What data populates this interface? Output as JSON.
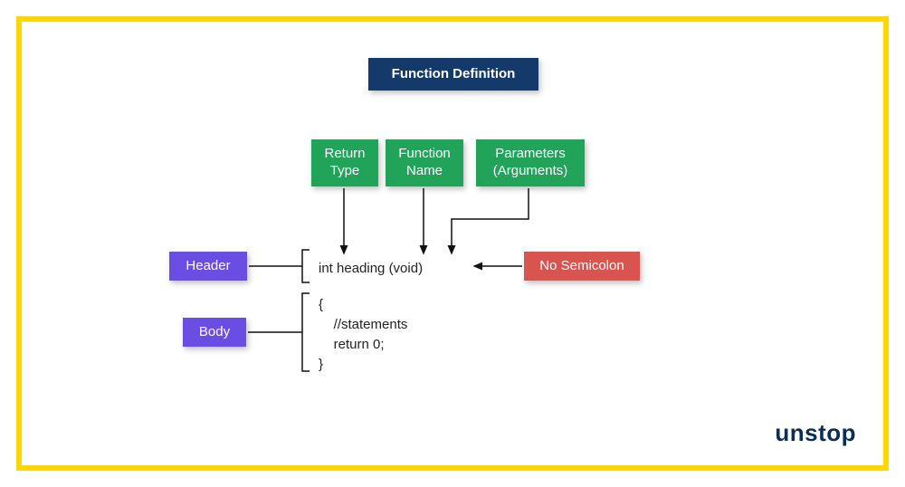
{
  "title": "Function Definition",
  "labels": {
    "return_type": "Return\nType",
    "function_name": "Function\nName",
    "parameters": "Parameters\n(Arguments)",
    "header": "Header",
    "body": "Body",
    "no_semicolon": "No Semicolon"
  },
  "code": {
    "signature": "int heading (void)",
    "body_line1": "{",
    "body_line2": "    //statements",
    "body_line3": "    return 0;",
    "body_line4": "}"
  },
  "logo_text": "unstop"
}
